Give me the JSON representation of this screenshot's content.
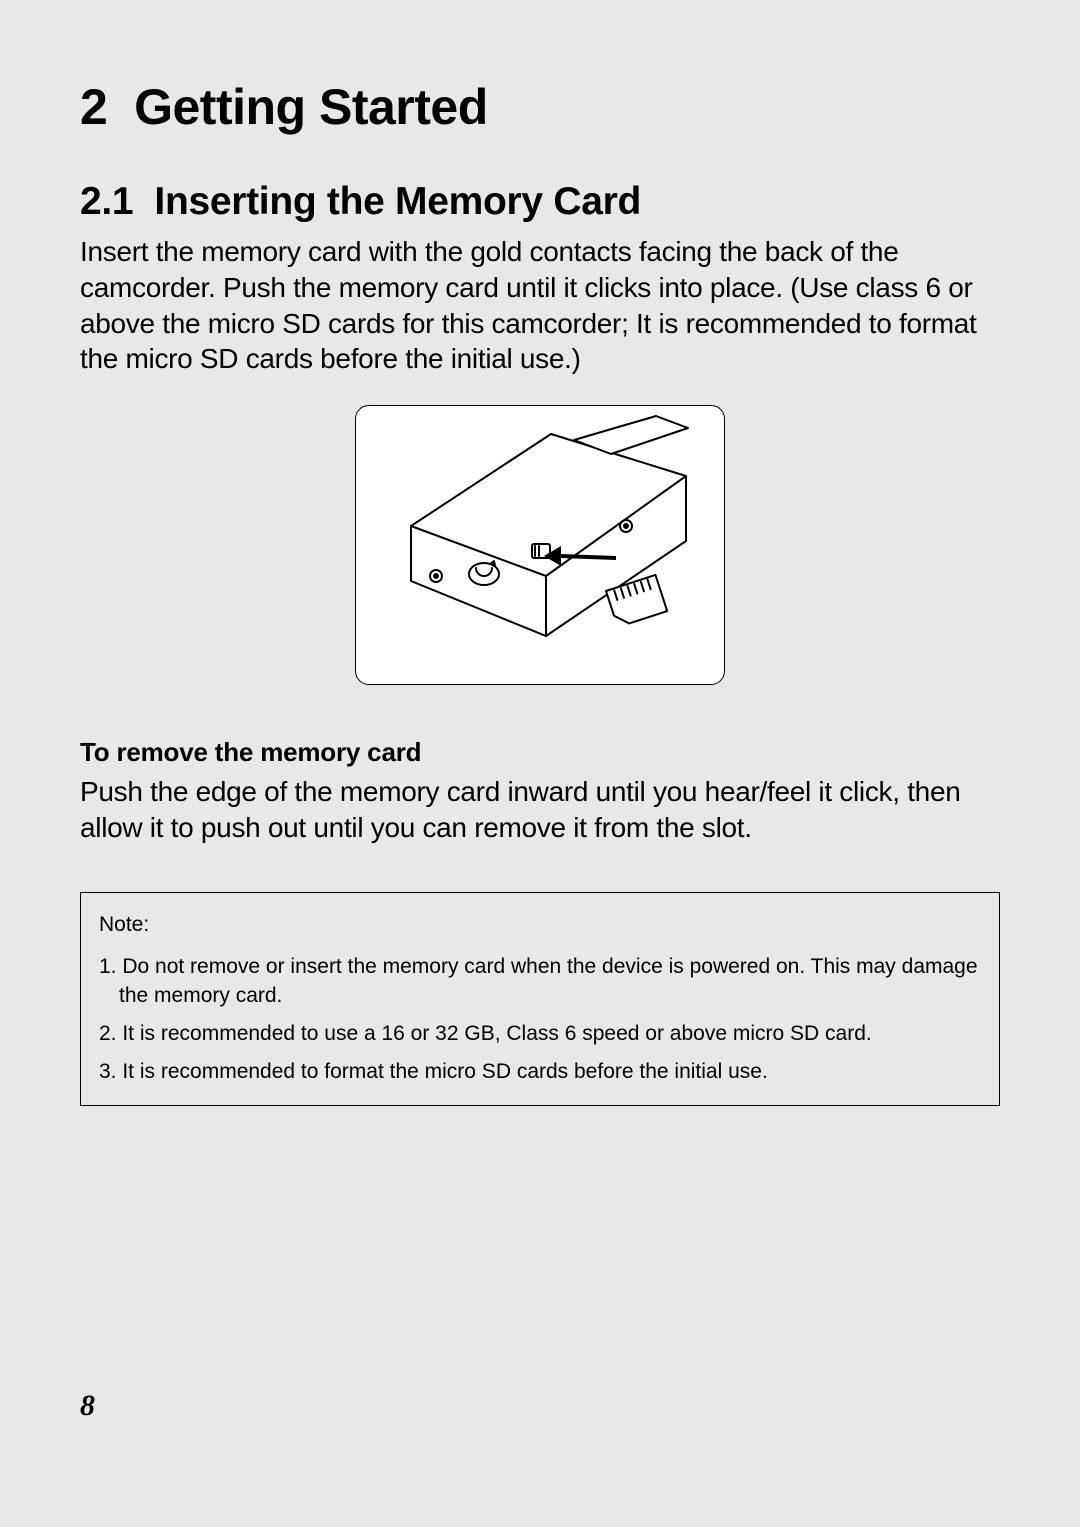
{
  "chapter": {
    "number": "2",
    "title": "Getting Started"
  },
  "section": {
    "number": "2.1",
    "title": "Inserting the Memory Card"
  },
  "paragraphs": {
    "intro": "Insert the memory card with the gold contacts facing the back of the camcorder. Push the memory card until it clicks into place. (Use class 6 or above the micro SD cards for this camcorder; It is recommended to format the micro SD cards before the initial use.)"
  },
  "subsection": {
    "heading": "To remove the memory card",
    "body": "Push the edge of the memory card inward until you hear/feel it click, then allow it to push out until you can remove it from the slot."
  },
  "note": {
    "label": "Note:",
    "items": [
      "1. Do not remove or insert the memory card when the device is powered on. This may damage the memory card.",
      "2. It is recommended to use a 16 or 32 GB, Class 6 speed or above micro SD card.",
      "3. It is recommended to format the micro SD cards before the initial use."
    ]
  },
  "illustration_alt": "camcorder-sd-insert-illustration",
  "page_number": "8"
}
